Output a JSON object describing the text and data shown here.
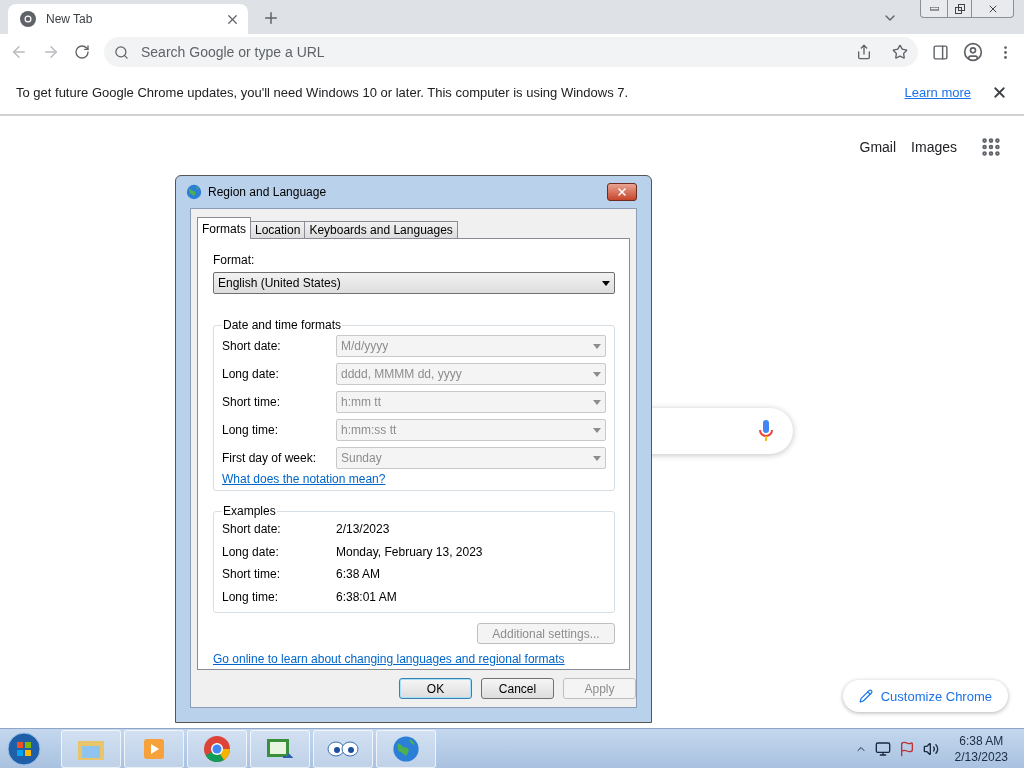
{
  "browser": {
    "tabs": [
      {
        "title": "New Tab",
        "selected": true
      }
    ],
    "omnibox": {
      "placeholder": "Search Google or type a URL"
    },
    "infobar": {
      "message": "To get future Google Chrome updates, you'll need Windows 10 or later. This computer is using Windows 7.",
      "link": "Learn more"
    }
  },
  "new_tab_page": {
    "links": [
      "Gmail",
      "Images"
    ],
    "customize": "Customize Chrome"
  },
  "dialog": {
    "title": "Region and Language",
    "tabs": [
      {
        "label": "Formats",
        "selected": true
      },
      {
        "label": "Location",
        "selected": false
      },
      {
        "label": "Keyboards and Languages",
        "selected": false
      }
    ],
    "format_label": "Format:",
    "format_value": "English (United States)",
    "group_title": "Date and time formats",
    "formats": [
      {
        "label": "Short date:",
        "value": "M/d/yyyy",
        "disabled": true
      },
      {
        "label": "Long date:",
        "value": "dddd, MMMM dd, yyyy",
        "disabled": true
      },
      {
        "label": "Short time:",
        "value": "h:mm tt",
        "disabled": true
      },
      {
        "label": "Long time:",
        "value": "h:mm:ss tt",
        "disabled": true
      },
      {
        "label": "First day of week:",
        "value": "Sunday",
        "disabled": true
      }
    ],
    "notation_link": "What does the notation mean?",
    "examples_title": "Examples",
    "examples": [
      {
        "label": "Short date:",
        "value": "2/13/2023"
      },
      {
        "label": "Long date:",
        "value": "Monday, February 13, 2023"
      },
      {
        "label": "Short time:",
        "value": "6:38 AM"
      },
      {
        "label": "Long time:",
        "value": "6:38:01 AM"
      }
    ],
    "additional": {
      "label": "Additional settings...",
      "disabled": true
    },
    "online_link": "Go online to learn about changing languages and regional formats",
    "buttons": [
      {
        "label": "OK",
        "default": true,
        "disabled": false
      },
      {
        "label": "Cancel",
        "default": false,
        "disabled": false
      },
      {
        "label": "Apply",
        "default": false,
        "disabled": true
      }
    ]
  },
  "taskbar": {
    "clock": {
      "time": "6:38 AM",
      "date": "2/13/2023"
    }
  }
}
